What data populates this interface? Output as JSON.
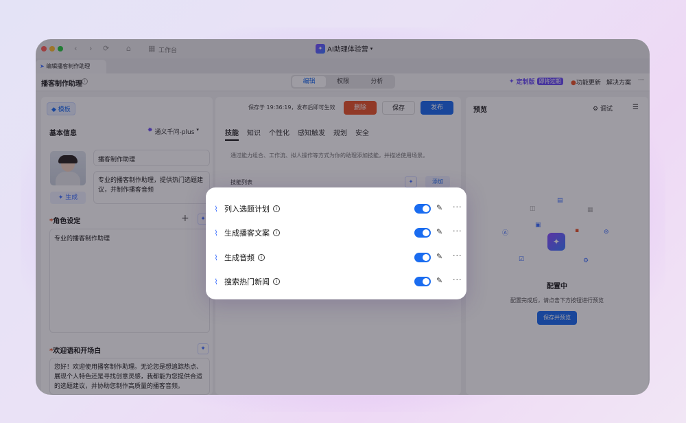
{
  "window": {
    "app_title": "AI助理体验营",
    "app_title_caret": "▾",
    "workspace_label": "工作台",
    "tab_title": "编辑播客制作助理"
  },
  "header": {
    "assistant_name": "播客制作助理",
    "tabs": [
      {
        "label": "编辑",
        "active": true
      },
      {
        "label": "权限",
        "active": false
      },
      {
        "label": "分析",
        "active": false
      }
    ],
    "custom_badge": "定制版",
    "expiring_badge": "即将过期",
    "feature_update": "功能更新",
    "solutions": "解决方案",
    "more": "···"
  },
  "toolbar": {
    "template_label": "模板",
    "save_status": "保存于 19:36:19，发布后即可生效",
    "delete_label": "删除",
    "save_label": "保存",
    "publish_label": "发布"
  },
  "basic_info": {
    "heading": "基本信息",
    "model": "通义千问-plus",
    "model_caret": "▾",
    "name": "播客制作助理",
    "description": "专业的播客制作助理，提供热门选题建议，并制作播客音频",
    "generate_label": "生成"
  },
  "role": {
    "heading": "角色设定",
    "text": "专业的播客制作助理",
    "add": "+"
  },
  "welcome": {
    "heading": "欢迎语和开场白",
    "text": "您好！欢迎使用播客制作助理。无论您是想追踪热点、展现个人特色还是寻找创意灵感，我都能为您提供合适的选题建议，并协助您制作高质量的播客音频。"
  },
  "config_tabs": [
    {
      "label": "技能",
      "active": true
    },
    {
      "label": "知识"
    },
    {
      "label": "个性化"
    },
    {
      "label": "感知触发"
    },
    {
      "label": "规划"
    },
    {
      "label": "安全"
    }
  ],
  "skills_section": {
    "hint": "通过能力组合、工作流、拟人操作等方式为你的助理添加技能，并描述使用场景。",
    "list_label": "技能列表",
    "add_label": "添加"
  },
  "skills": [
    {
      "name": "列入选题计划",
      "enabled": true
    },
    {
      "name": "生成播客文案",
      "enabled": true
    },
    {
      "name": "生成音频",
      "enabled": true
    },
    {
      "name": "搜索热门新闻",
      "enabled": true
    }
  ],
  "preview": {
    "heading": "预览",
    "debug_label": "调试",
    "status_title": "配置中",
    "status_desc": "配置完成后，请点击下方按钮进行预览",
    "save_preview_label": "保存并预览"
  },
  "colors": {
    "accent": "#1a6cf0",
    "danger": "#e8552a",
    "brand_purple": "#6a4cf5"
  }
}
